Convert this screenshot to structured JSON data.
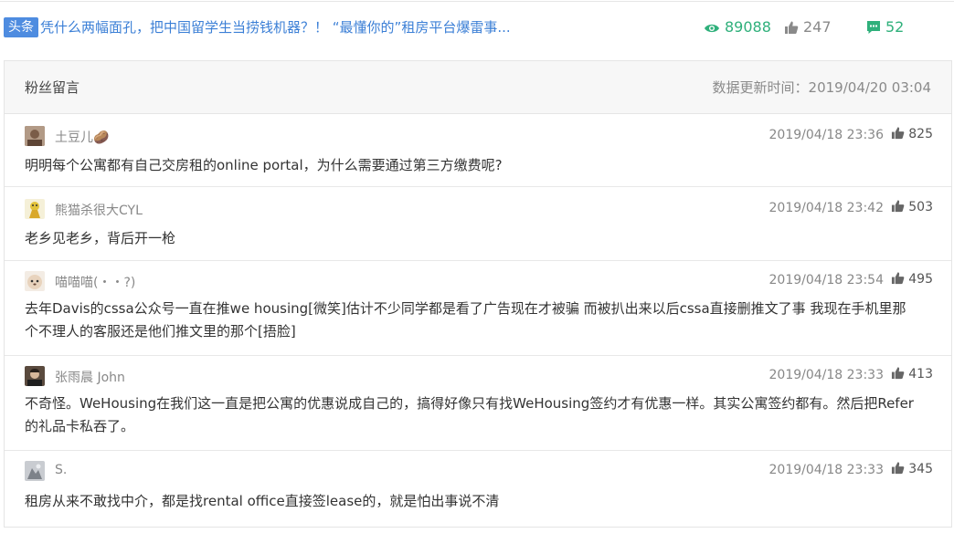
{
  "article": {
    "tag": "头条",
    "title": "凭什么两幅面孔，把中国留学生当捞钱机器？！ “最懂你的”租房平台爆雷事...",
    "views": "89088",
    "likes": "247",
    "comments": "52",
    "colors": {
      "accent_blue": "#3b7fd6",
      "accent_green": "#2fb07b"
    }
  },
  "panel": {
    "title": "粉丝留言",
    "updated": "数据更新时间：2019/04/20 03:04"
  },
  "comments": [
    {
      "user": "土豆儿🥔",
      "time": "2019/04/18 23:36",
      "likes": "825",
      "text": "明明每个公寓都有自己交房租的online portal，为什么需要通过第三方缴费呢?"
    },
    {
      "user": "熊猫杀很大CYL",
      "time": "2019/04/18 23:42",
      "likes": "503",
      "text": "老乡见老乡，背后开一枪"
    },
    {
      "user": "喵喵喵(・・?)",
      "time": "2019/04/18 23:54",
      "likes": "495",
      "text": "去年Davis的cssa公众号一直在推we housing[微笑]估计不少同学都是看了广告现在才被骗 而被扒出来以后cssa直接删推文了事 我现在手机里那个不理人的客服还是他们推文里的那个[捂脸]"
    },
    {
      "user": "张雨晨 John",
      "time": "2019/04/18 23:33",
      "likes": "413",
      "text": "不奇怪。WeHousing在我们这一直是把公寓的优惠说成自己的，搞得好像只有找WeHousing签约才有优惠一样。其实公寓签约都有。然后把Refer的礼品卡私吞了。"
    },
    {
      "user": "S.",
      "time": "2019/04/18 23:33",
      "likes": "345",
      "text": "租房从来不敢找中介，都是找rental office直接签lease的，就是怕出事说不清"
    }
  ]
}
